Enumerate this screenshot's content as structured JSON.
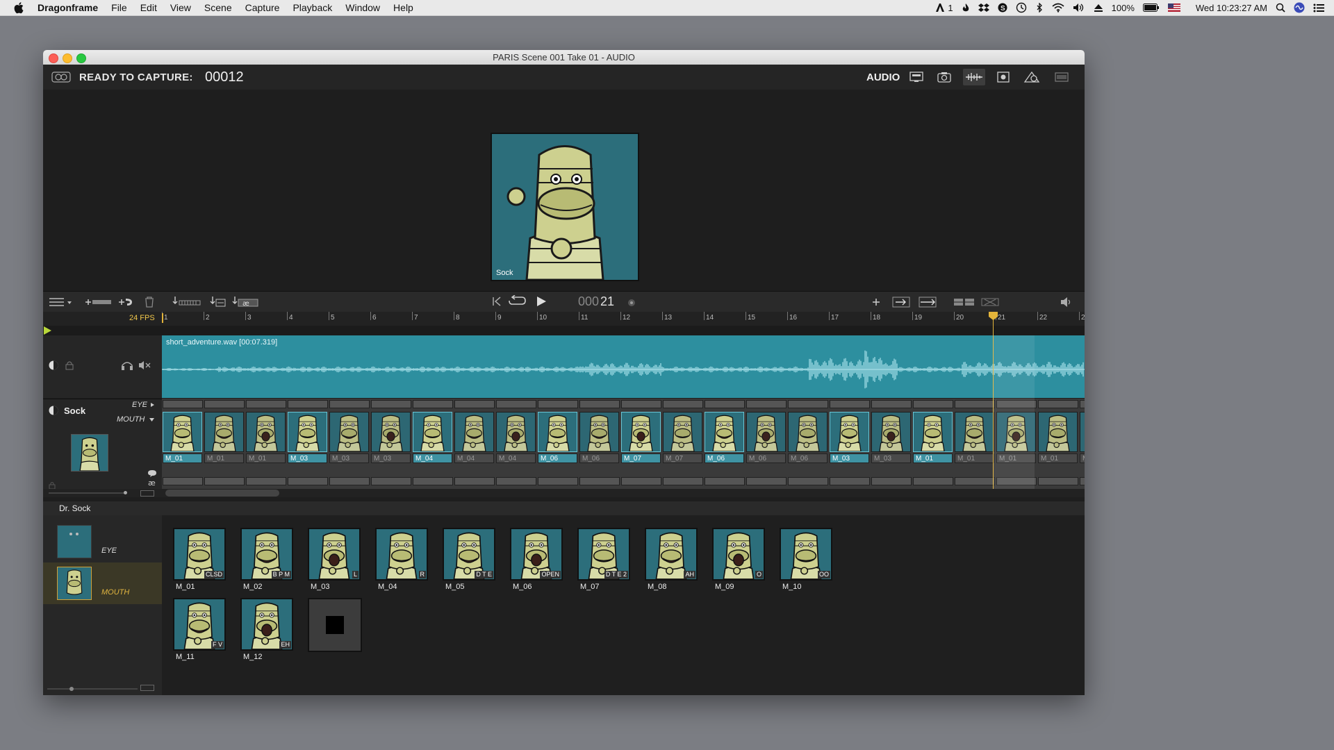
{
  "menubar": {
    "app": "Dragonframe",
    "items": [
      "File",
      "Edit",
      "View",
      "Scene",
      "Capture",
      "Playback",
      "Window",
      "Help"
    ],
    "right": {
      "adobe_label": "1",
      "battery": "100%",
      "datetime": "Wed 10:23:27 AM"
    }
  },
  "window": {
    "title": "PARIS  Scene 001  Take 01 - AUDIO",
    "status_label": "READY TO CAPTURE:",
    "capture_frame": "00012",
    "mode_label": "AUDIO",
    "preview_label": "Sock"
  },
  "timeline": {
    "fps": "24 FPS",
    "playhead_frame_prefix": "000",
    "playhead_frame": "21",
    "ruler_ticks": [
      "1",
      "2",
      "3",
      "4",
      "5",
      "6",
      "7",
      "8",
      "9",
      "10",
      "11",
      "12",
      "13",
      "14",
      "15",
      "16",
      "17",
      "18",
      "19",
      "20",
      "21",
      "22",
      "2"
    ],
    "audio_clip": "short_adventure.wav [00:07.319]",
    "character": "Sock",
    "tracks": [
      "EYE",
      "MOUTH"
    ],
    "mouth_frames": [
      {
        "label": "M_01",
        "key": true
      },
      {
        "label": "M_01",
        "key": false
      },
      {
        "label": "M_01",
        "key": false
      },
      {
        "label": "M_03",
        "key": true
      },
      {
        "label": "M_03",
        "key": false
      },
      {
        "label": "M_03",
        "key": false
      },
      {
        "label": "M_04",
        "key": true
      },
      {
        "label": "M_04",
        "key": false
      },
      {
        "label": "M_04",
        "key": false
      },
      {
        "label": "M_06",
        "key": true
      },
      {
        "label": "M_06",
        "key": false
      },
      {
        "label": "M_07",
        "key": true
      },
      {
        "label": "M_07",
        "key": false
      },
      {
        "label": "M_06",
        "key": true
      },
      {
        "label": "M_06",
        "key": false
      },
      {
        "label": "M_06",
        "key": false
      },
      {
        "label": "M_03",
        "key": true
      },
      {
        "label": "M_03",
        "key": false
      },
      {
        "label": "M_01",
        "key": true
      },
      {
        "label": "M_01",
        "key": false
      },
      {
        "label": "M_01",
        "key": false
      },
      {
        "label": "M_01",
        "key": false
      },
      {
        "label": "M",
        "key": false
      }
    ]
  },
  "library": {
    "title": "Dr. Sock",
    "groups": [
      "EYE",
      "MOUTH"
    ],
    "replacements": [
      {
        "name": "M_01",
        "tag": "CLSD"
      },
      {
        "name": "M_02",
        "tag": "B P M"
      },
      {
        "name": "M_03",
        "tag": "L"
      },
      {
        "name": "M_04",
        "tag": "R"
      },
      {
        "name": "M_05",
        "tag": "D T E"
      },
      {
        "name": "M_06",
        "tag": "OPEN"
      },
      {
        "name": "M_07",
        "tag": "D T E 2"
      },
      {
        "name": "M_08",
        "tag": "AH"
      },
      {
        "name": "M_09",
        "tag": "O"
      },
      {
        "name": "M_10",
        "tag": "OO"
      },
      {
        "name": "M_11",
        "tag": "F V"
      },
      {
        "name": "M_12",
        "tag": "EH"
      }
    ]
  },
  "colors": {
    "track_teal": "#2d8f9f",
    "playhead": "#e3b43a",
    "fps_yellow": "#f2c84b"
  }
}
